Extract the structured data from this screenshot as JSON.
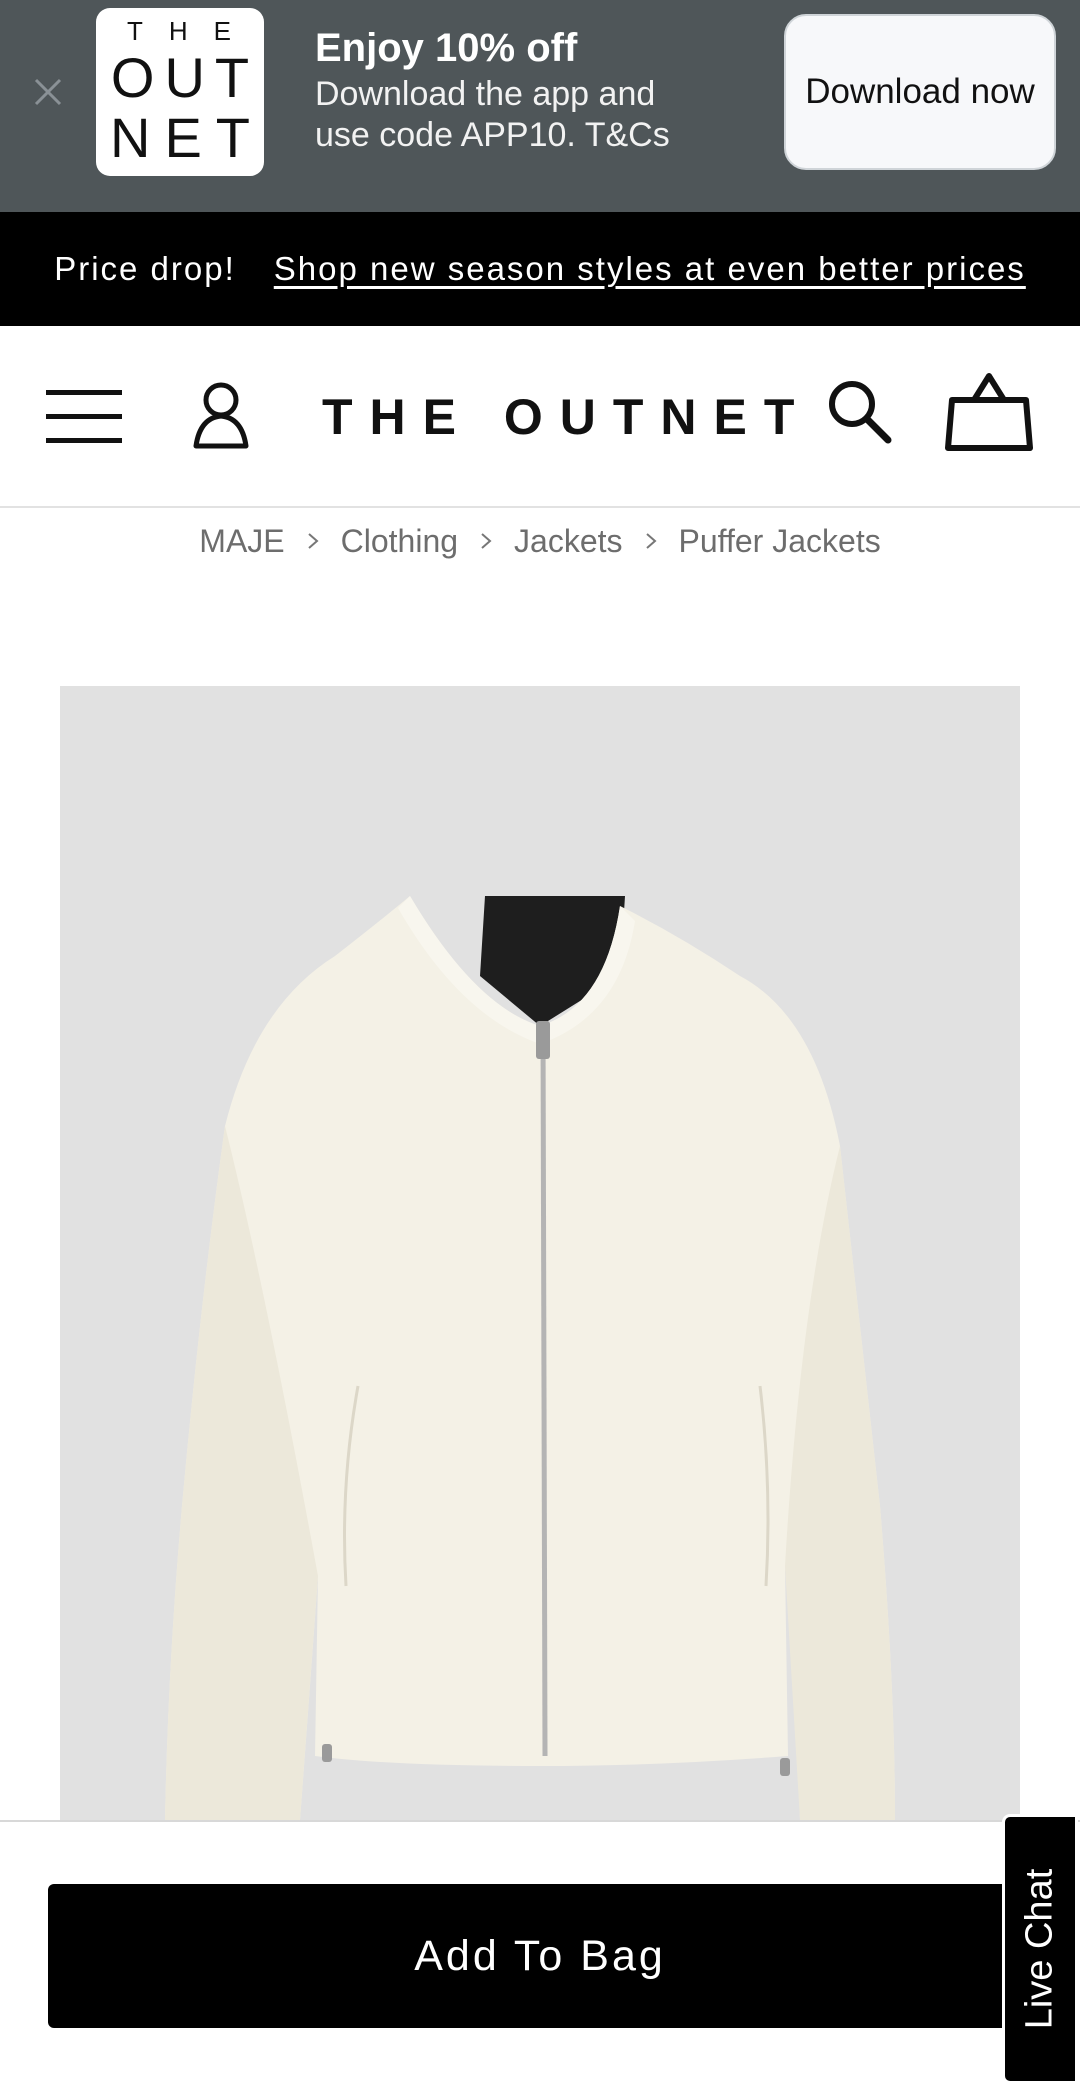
{
  "app_banner": {
    "close_icon": "close-icon",
    "logo_lines": [
      "THE",
      "OUT",
      "NET"
    ],
    "title": "Enjoy 10% off",
    "subtitle_line1": "Download the app and",
    "subtitle_line2": "use code APP10. T&Cs",
    "cta_label": "Download now"
  },
  "promo_bar": {
    "label": "Price drop!",
    "link_text": "Shop new season styles at even better prices"
  },
  "header": {
    "logo_text": "THE OUTNET",
    "icons": [
      "menu-icon",
      "account-icon",
      "search-icon",
      "bag-icon"
    ]
  },
  "breadcrumb": {
    "items": [
      "MAJE",
      "Clothing",
      "Jackets",
      "Puffer Jackets"
    ]
  },
  "product": {
    "image_icon": "jacket-image"
  },
  "actions": {
    "add_to_bag_label": "Add To Bag",
    "live_chat_label": "Live Chat"
  },
  "colors": {
    "banner_bg": "#4f5659",
    "promo_bg": "#000000",
    "image_bg": "#e1e1e1",
    "button_bg": "#000000"
  }
}
